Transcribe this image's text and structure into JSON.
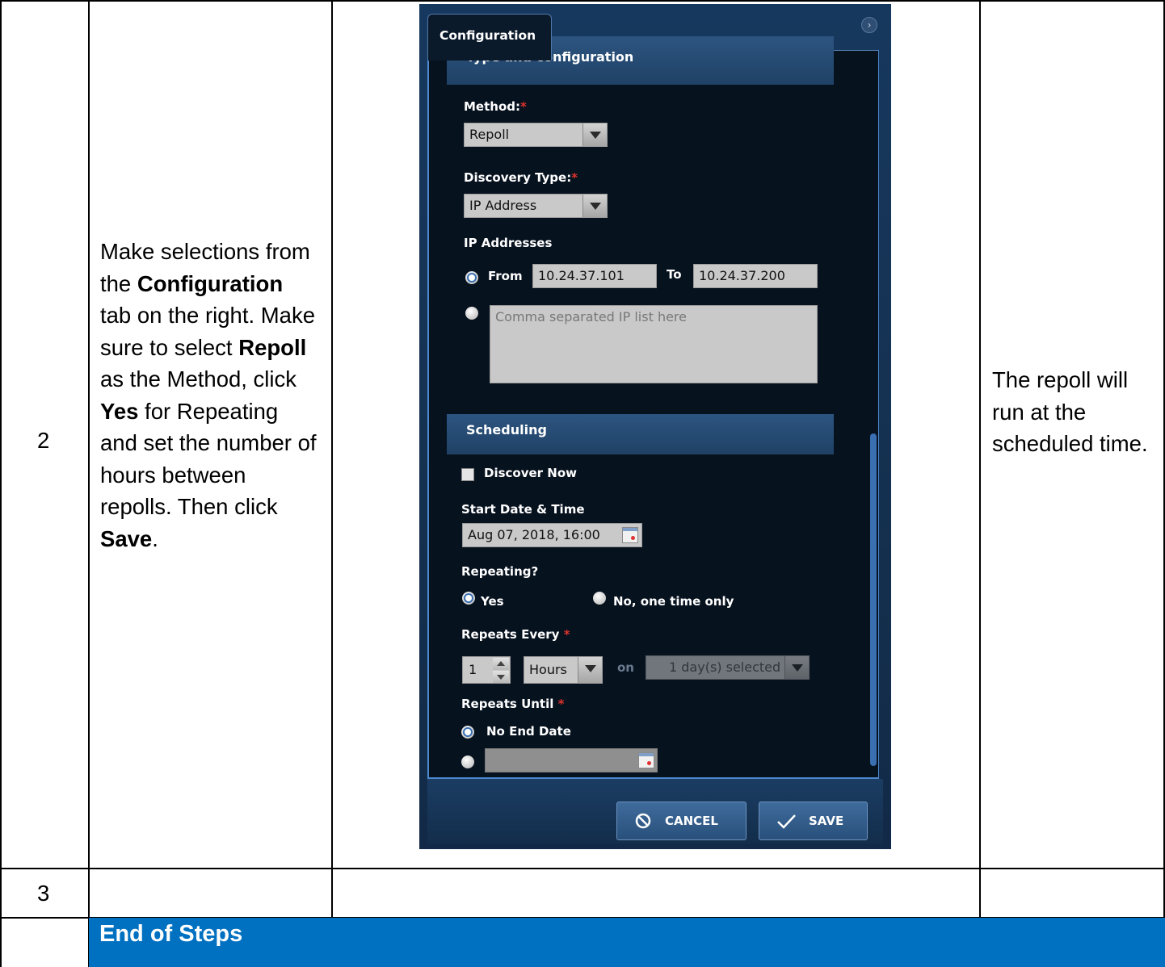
{
  "table": {
    "row2": {
      "step": "2",
      "instructions": {
        "p1": "Make selections from the ",
        "b1": "Configuration",
        "p2": " tab on the right. Make sure to select ",
        "b2": "Repoll",
        "p3": " as the Method, click ",
        "b3": "Yes",
        "p4": " for Repeating and set the number of hours between repolls. Then click ",
        "b4": "Save",
        "p5": "."
      },
      "result": "The repoll will run at the scheduled time."
    },
    "row3": {
      "step": "3"
    },
    "end_label": "End of Steps"
  },
  "screenshot": {
    "tab_label": "Configuration",
    "collapse_glyph": "›",
    "type_section_title": "Type and configuration",
    "method": {
      "label": "Method:",
      "required": "*",
      "value": "Repoll"
    },
    "discovery_type": {
      "label": "Discovery Type:",
      "required": "*",
      "value": "IP Address"
    },
    "ip_addresses": {
      "label": "IP Addresses",
      "from_label": "From",
      "from_value": "10.24.37.101",
      "to_label": "To",
      "to_value": "10.24.37.200",
      "list_placeholder": "Comma separated IP list here"
    },
    "scheduling_title": "Scheduling",
    "discover_now_label": "Discover Now",
    "start": {
      "label": "Start Date & Time",
      "value": "Aug 07, 2018, 16:00"
    },
    "repeating": {
      "label": "Repeating?",
      "yes": "Yes",
      "no": "No, one time only"
    },
    "repeats_every": {
      "label": "Repeats Every",
      "required": "*",
      "count": "1",
      "unit": "Hours",
      "on_label": "on",
      "days": "1 day(s) selected"
    },
    "repeats_until": {
      "label": "Repeats Until",
      "required": "*",
      "no_end": "No End Date"
    },
    "buttons": {
      "cancel": "CANCEL",
      "save": "SAVE"
    },
    "icons": {
      "cancel": "no-entry-icon",
      "save": "checkmark-icon",
      "calendar": "calendar-icon"
    }
  }
}
